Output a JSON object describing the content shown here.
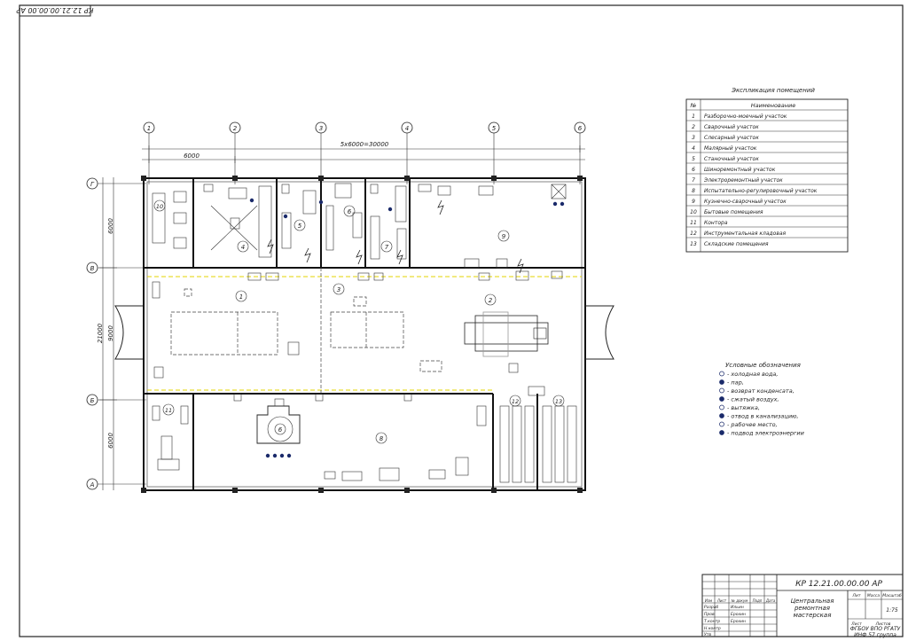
{
  "stamp_top": "КР 12.21.00.00.00 АР",
  "axes_top": [
    "1",
    "2",
    "3",
    "4",
    "5",
    "6"
  ],
  "axes_left": [
    "Г",
    "В",
    "Б",
    "А"
  ],
  "dims": {
    "first_span": "6000",
    "total_span": "5х6000=30000",
    "left_top": "6000",
    "left_mid": "9000",
    "left_total": "21000",
    "left_bottom": "6000"
  },
  "rooms_labels": [
    "1",
    "2",
    "3",
    "4",
    "5",
    "6",
    "7",
    "8",
    "9",
    "10",
    "11",
    "12",
    "13"
  ],
  "explication": {
    "title": "Экспликация помещений",
    "header_no": "№",
    "header_name": "Наименование",
    "rows": [
      {
        "no": "1",
        "name": "Разборочно-моечный участок"
      },
      {
        "no": "2",
        "name": "Сварочный участок"
      },
      {
        "no": "3",
        "name": "Слесарный участок"
      },
      {
        "no": "4",
        "name": "Малярный участок"
      },
      {
        "no": "5",
        "name": "Станочный участок"
      },
      {
        "no": "6",
        "name": "Шиноремонтный участок"
      },
      {
        "no": "7",
        "name": "Электроремонтный участок"
      },
      {
        "no": "8",
        "name": "Испытательно-регулировочный участок"
      },
      {
        "no": "9",
        "name": "Кузнечно-сварочный участок"
      },
      {
        "no": "10",
        "name": "Бытовые помещения"
      },
      {
        "no": "11",
        "name": "Контора"
      },
      {
        "no": "12",
        "name": "Инструментальная кладовая"
      },
      {
        "no": "13",
        "name": "Складские помещения"
      }
    ]
  },
  "legend": {
    "title": "Условные обозначения",
    "items": [
      "- холодная вода,",
      "- пар,",
      "- возврат конденсата,",
      "- сжатый воздух,",
      "- вытяжка,",
      "- отвод в канализацию,",
      "- рабочее место,",
      "- подвод электроэнергии"
    ]
  },
  "title_block": {
    "code": "КР 12.21.00.00.00 АР",
    "name_line1": "Центральная",
    "name_line2": "ремонтная",
    "name_line3": "мастерская",
    "lit": "Лит",
    "mass": "Масса",
    "scale": "Масштаб",
    "scale_value": "1:75",
    "sheet": "Лист",
    "sheets": "Листов",
    "org_line1": "ФГБОУ ВПО РГАТУ",
    "org_line2": "ИНФ 57 группа",
    "roles": [
      "Изм",
      "Лист",
      "№ докум",
      "Подп",
      "Дата",
      "Разраб",
      "Пров",
      "Т.контр",
      "Н.контр",
      "Утв"
    ],
    "names": [
      "Ильин",
      "Ерохин",
      "Ерохин"
    ]
  },
  "equipment": {
    "tag1": "1",
    "tag2": "2",
    "tag3": "3",
    "tag4": "4",
    "tag5": "5",
    "tag6": "6",
    "tag7": "7",
    "tag8": "8"
  }
}
